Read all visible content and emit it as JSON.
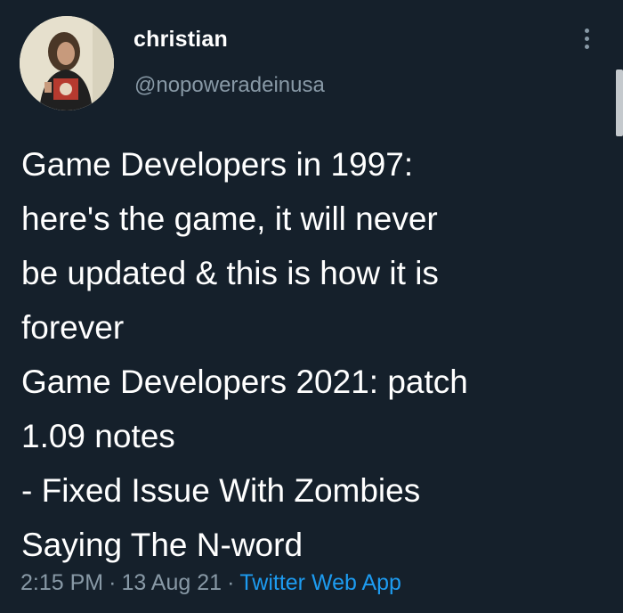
{
  "author": {
    "display_name": "christian",
    "handle": "@nopoweradeinusa"
  },
  "tweet": {
    "lines": [
      "Game Developers in 1997:",
      "here's the game, it will never",
      "be updated & this is how it is",
      "forever",
      "Game Developers 2021: patch",
      "1.09 notes",
      "- Fixed Issue With Zombies",
      "Saying The N-word"
    ]
  },
  "meta": {
    "time": "2:15 PM",
    "separator": "·",
    "date": "13 Aug 21",
    "source": "Twitter Web App"
  },
  "icons": {
    "more": "more-options-icon"
  },
  "colors": {
    "background": "#15202b",
    "text": "#ffffff",
    "secondary": "#8899a6",
    "link": "#1d9bf0"
  }
}
